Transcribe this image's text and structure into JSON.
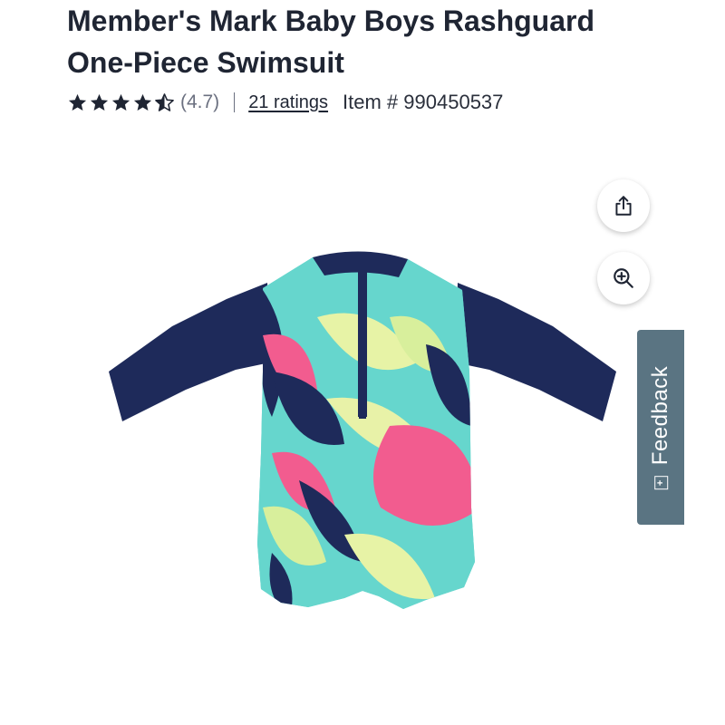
{
  "product": {
    "title_line1": "Member's Mark Baby Boys Rashguard",
    "title_line2": "One-Piece Swimsuit",
    "rating_display": "(4.7)",
    "rating_value": 4.7,
    "ratings_link": "21 ratings",
    "item_number": "Item # 990450537"
  },
  "actions": {
    "share_icon": "share-icon",
    "zoom_icon": "zoom-in-icon"
  },
  "feedback": {
    "label": "Feedback",
    "icon_glyph": "+"
  },
  "colors": {
    "navy": "#1e2a5a",
    "star": "#1f2533",
    "feedback_bg": "#5a7482"
  }
}
